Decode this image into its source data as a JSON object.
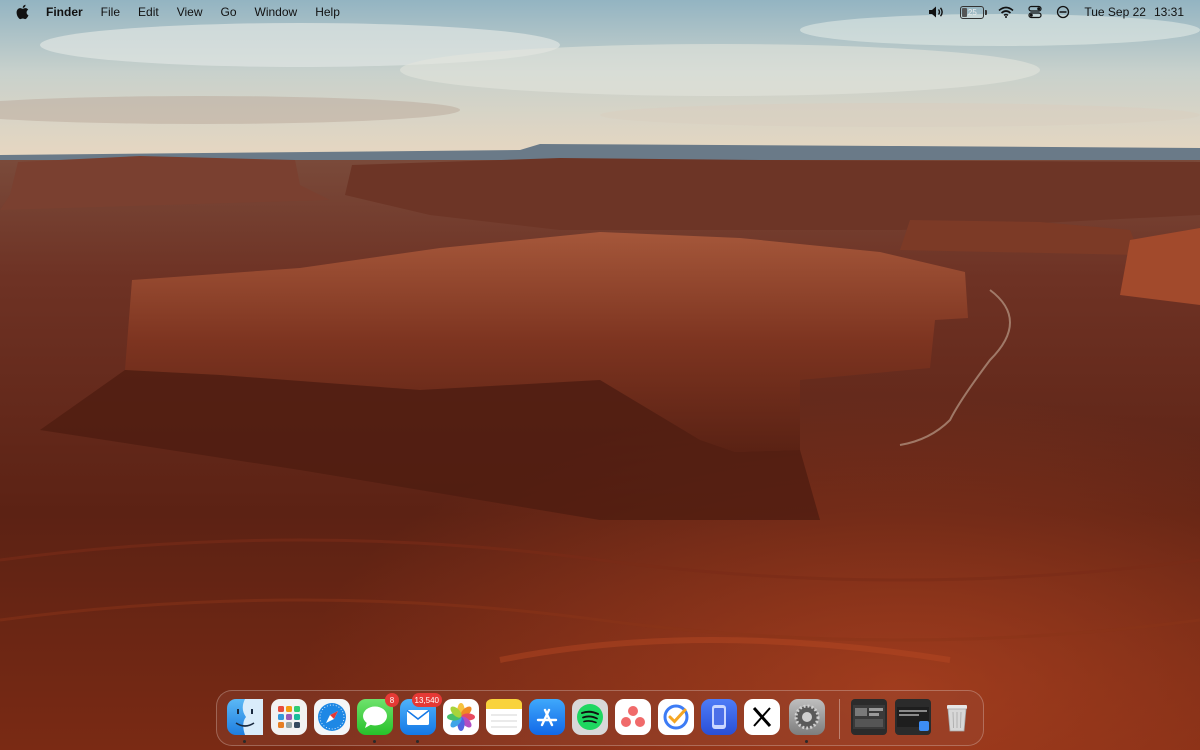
{
  "menubar": {
    "apple_icon": "apple-icon",
    "app_name": "Finder",
    "menus": [
      "File",
      "Edit",
      "View",
      "Go",
      "Window",
      "Help"
    ],
    "status": {
      "battery_level": "25",
      "date": "Tue Sep 22",
      "time": "13:31"
    },
    "status_icons": [
      "volume-icon",
      "battery-icon",
      "wifi-icon",
      "control-center-icon",
      "focus-icon"
    ]
  },
  "dock": {
    "apps": [
      {
        "name": "Finder",
        "icon": "finder-icon"
      },
      {
        "name": "Launchpad",
        "icon": "launchpad-icon"
      },
      {
        "name": "Safari",
        "icon": "safari-icon"
      },
      {
        "name": "Messages",
        "icon": "messages-icon",
        "badge": "8"
      },
      {
        "name": "Mail",
        "icon": "mail-icon",
        "badge": "13,540"
      },
      {
        "name": "Photos",
        "icon": "photos-icon"
      },
      {
        "name": "Notes",
        "icon": "notes-icon"
      },
      {
        "name": "App Store",
        "icon": "app-store-icon"
      },
      {
        "name": "Spotify",
        "icon": "spotify-icon"
      },
      {
        "name": "Asana",
        "icon": "asana-icon"
      },
      {
        "name": "Tasks",
        "icon": "tasks-icon"
      },
      {
        "name": "Simulator",
        "icon": "simulator-icon"
      },
      {
        "name": "X",
        "icon": "x-icon"
      },
      {
        "name": "System Settings",
        "icon": "settings-icon"
      }
    ],
    "recents": [
      {
        "name": "Screenshot window 1",
        "icon": "window-thumbnail-icon"
      },
      {
        "name": "Screenshot window 2",
        "icon": "window-thumbnail-icon"
      },
      {
        "name": "Trash",
        "icon": "trash-icon"
      }
    ],
    "running": [
      "Finder",
      "Messages",
      "Mail",
      "System Settings"
    ]
  },
  "colors": {
    "sky_top": "#9ab8c4",
    "sky_horizon": "#e6d6be",
    "mesa": "#8b3a22",
    "desert": "#6a2414",
    "badge": "#e53935"
  }
}
